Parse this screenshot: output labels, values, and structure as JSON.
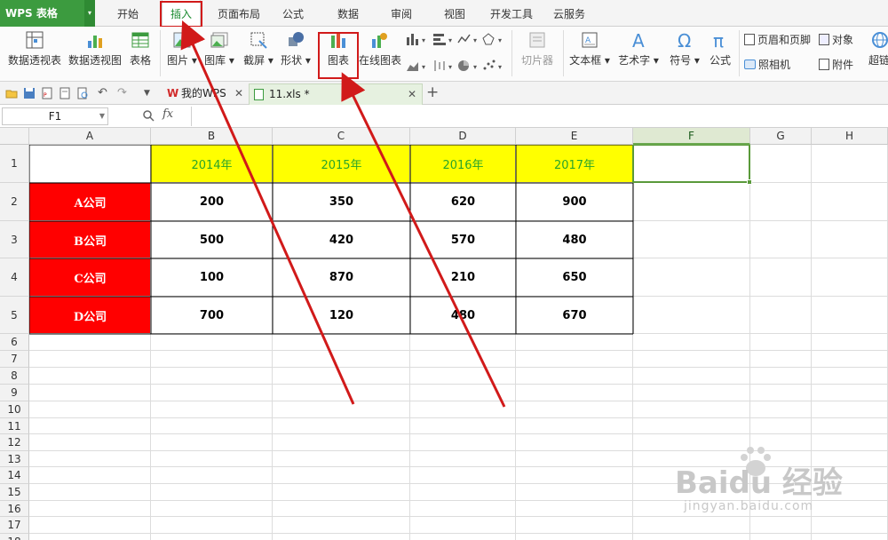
{
  "app": {
    "logo": "WPS 表格"
  },
  "menu_tabs": [
    "开始",
    "插入",
    "页面布局",
    "公式",
    "数据",
    "审阅",
    "视图",
    "开发工具",
    "云服务"
  ],
  "ribbon": {
    "pivot_table": "数据透视表",
    "pivot_chart": "数据透视图",
    "table": "表格",
    "picture": "图片",
    "gallery": "图库",
    "screenshot": "截屏",
    "shapes": "形状",
    "chart": "图表",
    "online_chart": "在线图表",
    "slicer": "切片器",
    "textbox": "文本框",
    "wordart": "艺术字",
    "symbol": "符号",
    "formula": "公式",
    "header_footer": "页眉和页脚",
    "camera": "照相机",
    "object": "对象",
    "attachment": "附件",
    "hyperlink": "超链"
  },
  "doc_tabs": [
    "我的WPS",
    "11.xls *"
  ],
  "formula_bar": {
    "name_box": "F1",
    "fx": "fx",
    "formula": ""
  },
  "columns": [
    "A",
    "B",
    "C",
    "D",
    "E",
    "F",
    "G",
    "H"
  ],
  "rows": [
    "1",
    "2",
    "3",
    "4",
    "5",
    "6",
    "7",
    "8",
    "9",
    "10",
    "11",
    "12",
    "13",
    "14",
    "15",
    "16",
    "17",
    "18"
  ],
  "table": {
    "years": [
      "2014年",
      "2015年",
      "2016年",
      "2017年"
    ],
    "companies": [
      {
        "name": "A公司",
        "values": [
          "200",
          "350",
          "620",
          "900"
        ]
      },
      {
        "name": "B公司",
        "values": [
          "500",
          "420",
          "570",
          "480"
        ]
      },
      {
        "name": "C公司",
        "values": [
          "100",
          "870",
          "210",
          "650"
        ]
      },
      {
        "name": "D公司",
        "values": [
          "700",
          "120",
          "480",
          "670"
        ]
      }
    ]
  },
  "colors": {
    "accent_green": "#3c9b3f",
    "header_yellow": "#ffff00",
    "company_red": "#ff0000",
    "highlight_red": "#d11a1a"
  },
  "watermark": {
    "brand": "Baidu 经验",
    "url": "jingyan.baidu.com"
  }
}
